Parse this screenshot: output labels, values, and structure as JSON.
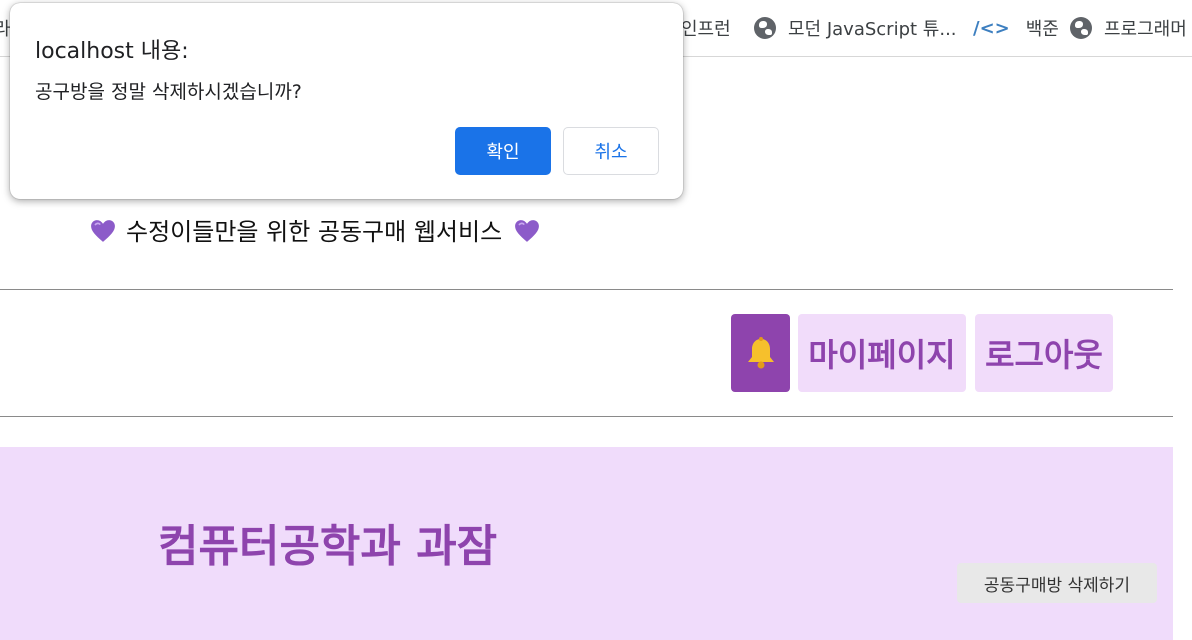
{
  "bookmarks": {
    "partial_left": "라",
    "inflearn": "인프런",
    "modern_js": "모던 JavaScript 튜...",
    "baekjoon_icon_text": "/<>",
    "baekjoon": "백준",
    "programmers": "프로그래머"
  },
  "dialog": {
    "title": "localhost 내용:",
    "message": "공구방을 정말 삭제하시겠습니까?",
    "ok_label": "확인",
    "cancel_label": "취소"
  },
  "page": {
    "tagline": "수정이들만을 위한 공동구매 웹서비스",
    "nav": {
      "mypage_label": "마이페이지",
      "logout_label": "로그아웃"
    },
    "room_title": "컴퓨터공학과 과잠",
    "delete_room_label": "공동구매방 삭제하기"
  },
  "colors": {
    "accent": "#8e44ad",
    "accent_light": "#f0dcfb",
    "dialog_primary": "#1a73e8"
  },
  "icons": {
    "bell": "bell-icon",
    "heart": "purple-heart-icon",
    "globe": "globe-icon"
  }
}
